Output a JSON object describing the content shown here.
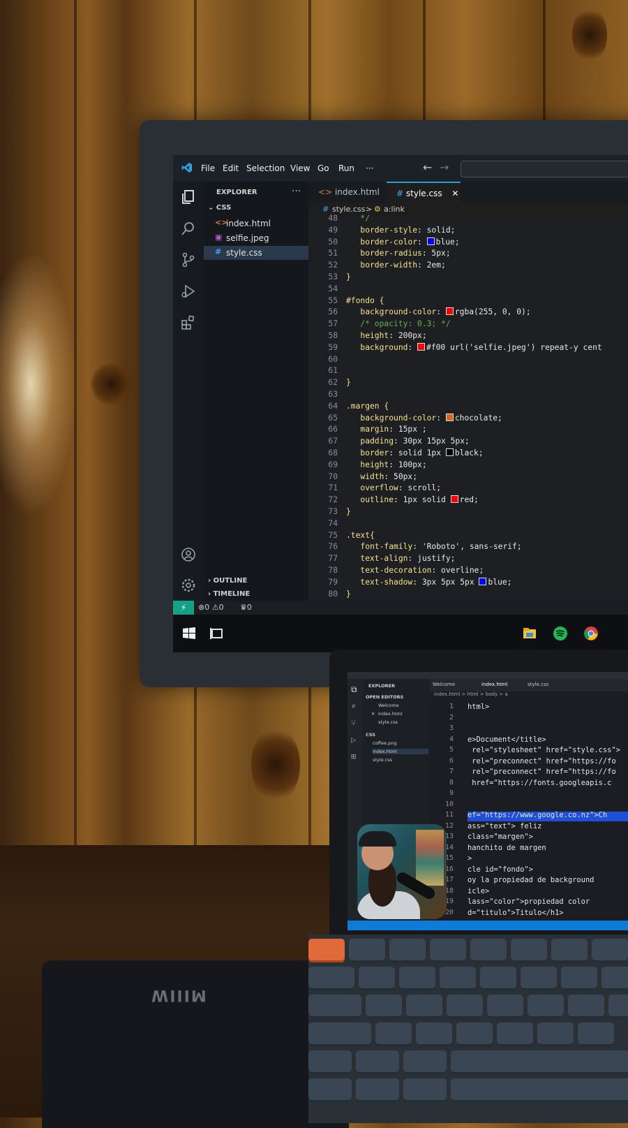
{
  "vscode": {
    "menu": [
      "File",
      "Edit",
      "Selection",
      "View",
      "Go",
      "Run",
      "···"
    ],
    "explorer_title": "EXPLORER",
    "explorer_more": "···",
    "folder": "CSS",
    "files": [
      {
        "name": "index.html",
        "icon": "<>",
        "icon_color": "#e37933"
      },
      {
        "name": "selfie.jpeg",
        "icon": "▣",
        "icon_color": "#b45fd0"
      },
      {
        "name": "style.css",
        "icon": "#",
        "icon_color": "#42a5f5"
      }
    ],
    "outline": "OUTLINE",
    "timeline": "TIMELINE",
    "tabs": [
      {
        "name": "index.html",
        "icon": "<>",
        "icon_color": "#e37933"
      },
      {
        "name": "style.css",
        "icon": "#",
        "icon_color": "#42a5f5",
        "close": "✕"
      }
    ],
    "breadcrumb_file": "style.css",
    "breadcrumb_sep": ">",
    "breadcrumb_symbol": "a:link",
    "status_problems": "⊗0 ⚠0",
    "status_ports": "♛0"
  },
  "code_lines": [
    {
      "n": "48",
      "text": "   */"
    },
    {
      "n": "49",
      "text": "   border-style: solid;"
    },
    {
      "n": "50",
      "text": "   border-color: ",
      "swatch": "#0000ff",
      "tail": "blue;"
    },
    {
      "n": "51",
      "text": "   border-radius: 5px;"
    },
    {
      "n": "52",
      "text": "   border-width: 2em;"
    },
    {
      "n": "53",
      "text": "}"
    },
    {
      "n": "54",
      "text": ""
    },
    {
      "n": "55",
      "text": "#fondo {"
    },
    {
      "n": "56",
      "text": "   background-color: ",
      "swatch": "#ff0000",
      "tail": "rgba(255, 0, 0);"
    },
    {
      "n": "57",
      "text": "   /* opacity: 0.3; */"
    },
    {
      "n": "58",
      "text": "   height: 200px;"
    },
    {
      "n": "59",
      "text": "   background: ",
      "swatch": "#ff0000",
      "tail": "#f00 url('selfie.jpeg') repeat-y cent"
    },
    {
      "n": "60",
      "text": ""
    },
    {
      "n": "61",
      "text": ""
    },
    {
      "n": "62",
      "text": "}"
    },
    {
      "n": "63",
      "text": ""
    },
    {
      "n": "64",
      "text": ".margen {"
    },
    {
      "n": "65",
      "text": "   background-color: ",
      "swatch": "#d2691e",
      "tail": "chocolate;"
    },
    {
      "n": "66",
      "text": "   margin: 15px ;"
    },
    {
      "n": "67",
      "text": "   padding: 30px 15px 5px;"
    },
    {
      "n": "68",
      "text": "   border: solid 1px ",
      "swatch": "#000000",
      "tail": "black;"
    },
    {
      "n": "69",
      "text": "   height: 100px;"
    },
    {
      "n": "70",
      "text": "   width: 50px;"
    },
    {
      "n": "71",
      "text": "   overflow: scroll;"
    },
    {
      "n": "72",
      "text": "   outline: 1px solid ",
      "swatch": "#ff0000",
      "tail": "red;"
    },
    {
      "n": "73",
      "text": "}"
    },
    {
      "n": "74",
      "text": ""
    },
    {
      "n": "75",
      "text": ".text{"
    },
    {
      "n": "76",
      "text": "   font-family: 'Roboto', sans-serif;"
    },
    {
      "n": "77",
      "text": "   text-align: justify;"
    },
    {
      "n": "78",
      "text": "   text-decoration: overline;"
    },
    {
      "n": "79",
      "text": "   text-shadow: 3px 5px 5px ",
      "swatch": "#0000ff",
      "tail": "blue;"
    },
    {
      "n": "80",
      "text": "}"
    }
  ],
  "laptop": {
    "explorer": "EXPLORER",
    "open_editors": "OPEN EDITORS",
    "open_files": [
      "Welcome",
      "index.html",
      "style.css"
    ],
    "folder": "CSS",
    "files": [
      "coffee.png",
      "index.html",
      "style.css"
    ],
    "tabs": [
      "Welcome",
      "index.html",
      "style.css"
    ],
    "breadcrumb": "index.html > html > body > a",
    "lines": [
      {
        "n": "1",
        "text": "html>"
      },
      {
        "n": "2",
        "text": ""
      },
      {
        "n": "3",
        "text": ""
      },
      {
        "n": "4",
        "text": "e>Document</title>"
      },
      {
        "n": "5",
        "text": " rel=\"stylesheet\" href=\"style.css\">"
      },
      {
        "n": "6",
        "text": " rel=\"preconnect\" href=\"https://fo"
      },
      {
        "n": "7",
        "text": " rel=\"preconnect\" href=\"https://fo"
      },
      {
        "n": "8",
        "text": " href=\"https://fonts.googleapis.c"
      },
      {
        "n": "9",
        "text": ""
      },
      {
        "n": "10",
        "text": ""
      },
      {
        "n": "11",
        "text": "ef=\"https://www.google.co.nz\">Ch"
      },
      {
        "n": "12",
        "text": "ass=\"text\"> feliz"
      },
      {
        "n": "13",
        "text": "class=\"margen\">"
      },
      {
        "n": "14",
        "text": "hanchito de margen"
      },
      {
        "n": "15",
        "text": ">"
      },
      {
        "n": "16",
        "text": "cle id=\"fondo\">"
      },
      {
        "n": "17",
        "text": "oy la propiedad de background"
      },
      {
        "n": "18",
        "text": "icle>"
      },
      {
        "n": "19",
        "text": "lass=\"color\">propiedad color"
      },
      {
        "n": "20",
        "text": "d=\"titulo\">Titulo</h1>"
      }
    ]
  },
  "mousepad_logo": "MIIIW"
}
